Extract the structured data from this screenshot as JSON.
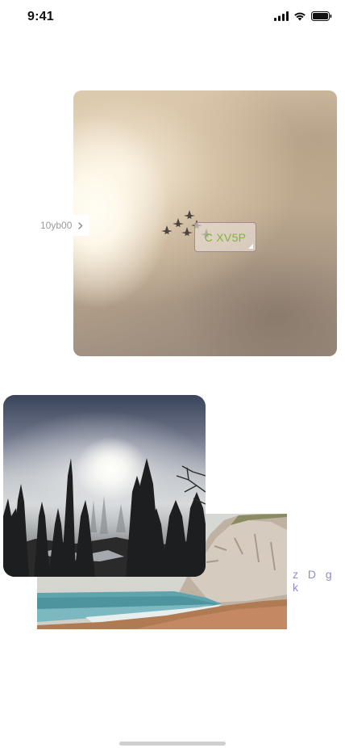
{
  "status_bar": {
    "time": "9:41",
    "icons": [
      "cellular-signal-icon",
      "wifi-icon",
      "battery-icon"
    ]
  },
  "hero_card": {
    "image": "foggy-sky-with-jet-formation",
    "tag_text": "C XV5P",
    "tag_text_color": "#7fb43a"
  },
  "left_chip": {
    "label": "10yb00",
    "icon": "chevron-right-icon"
  },
  "forest_card": {
    "image": "misty-pine-forest"
  },
  "beach_card": {
    "image": "beach-with-chalk-cliffs"
  },
  "right_label": {
    "text": "z D g k",
    "color": "#8c8cd0"
  }
}
